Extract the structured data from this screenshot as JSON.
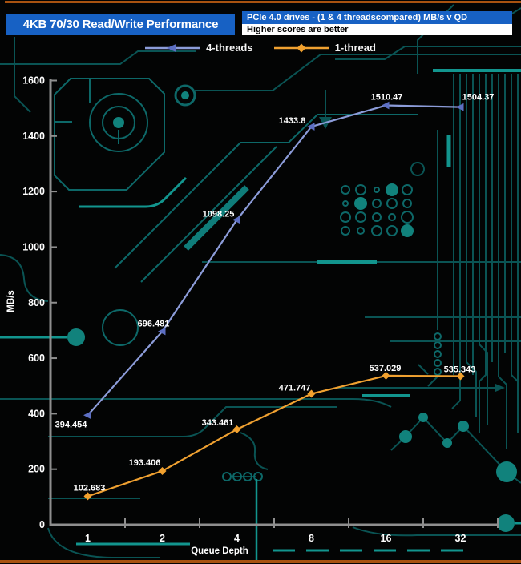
{
  "header": {
    "title": "4KB 70/30 Read/Write Performance",
    "subtitle": "PCIe 4.0 drives - (1 & 4 threadscompared) MB/s v QD",
    "note": "Higher scores are better"
  },
  "chart_data": {
    "type": "line",
    "title": "4KB 70/30 Read/Write Performance",
    "xlabel": "Queue Depth",
    "ylabel": "MB/s",
    "x_categories": [
      "1",
      "2",
      "4",
      "8",
      "16",
      "32"
    ],
    "x_scale": "log2-category",
    "ylim": [
      0,
      1600
    ],
    "yticks": [
      0,
      200,
      400,
      600,
      800,
      1000,
      1200,
      1400,
      1600
    ],
    "grid": false,
    "data_labels": true,
    "legend_position": "top-center",
    "series": [
      {
        "name": "4-threads",
        "color": "#8c9cd9",
        "marker_color": "#5d6fc3",
        "marker": "triangle-left",
        "values": [
          394.454,
          696.481,
          1098.25,
          1433.8,
          1510.47,
          1504.37
        ]
      },
      {
        "name": "1-thread",
        "color": "#f0a131",
        "marker_color": "#f2a12e",
        "marker": "diamond",
        "values": [
          102.683,
          193.406,
          343.461,
          471.747,
          537.029,
          535.343
        ]
      }
    ]
  },
  "colors": {
    "background": "#030404",
    "circuit": "#0d6868",
    "circuit_bright": "#12958e",
    "header_blue": "#1761c4",
    "axis_gray": "#8f8f8f",
    "label_white": "#ffffff",
    "frame_orange": "#a85210"
  }
}
